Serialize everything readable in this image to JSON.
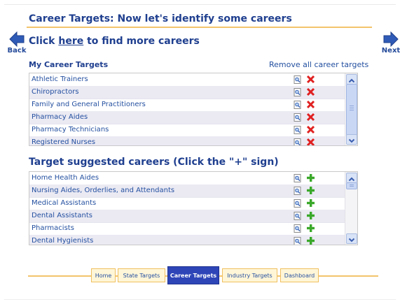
{
  "header": {
    "title": "Career Targets: Now let's identify some careers"
  },
  "nav": {
    "back_label": "Back",
    "next_label": "Next"
  },
  "intro": {
    "prefix": "Click ",
    "link": "here",
    "suffix": " to find more careers"
  },
  "my_targets": {
    "label": "My Career Targets",
    "remove_all_label": "Remove all career targets",
    "items": [
      "Athletic Trainers",
      "Chiropractors",
      "Family and General Practitioners",
      "Pharmacy Aides",
      "Pharmacy Technicians",
      "Registered Nurses"
    ]
  },
  "suggested": {
    "title": "Target suggested careers (Click the \"+\" sign)",
    "items": [
      "Home Health Aides",
      "Nursing Aides, Orderlies, and Attendants",
      "Medical Assistants",
      "Dental Assistants",
      "Pharmacists",
      "Dental Hygienists"
    ]
  },
  "tabs": [
    {
      "label": "Home"
    },
    {
      "label": "State Targets"
    },
    {
      "label": "Career Targets",
      "active": true
    },
    {
      "label": "Industry Targets"
    },
    {
      "label": "Dashboard"
    }
  ],
  "icons": {
    "view": "magnifier-page-icon",
    "remove": "red-x-icon",
    "add": "green-plus-icon",
    "back": "left-arrow-icon",
    "next": "right-arrow-icon"
  },
  "colors": {
    "accent": "#1f3f8f",
    "rule": "#f2c46b",
    "active_tab": "#2d45b7",
    "row_alt": "#ebeaf3",
    "remove": "#e02020",
    "add": "#3aa82a"
  }
}
